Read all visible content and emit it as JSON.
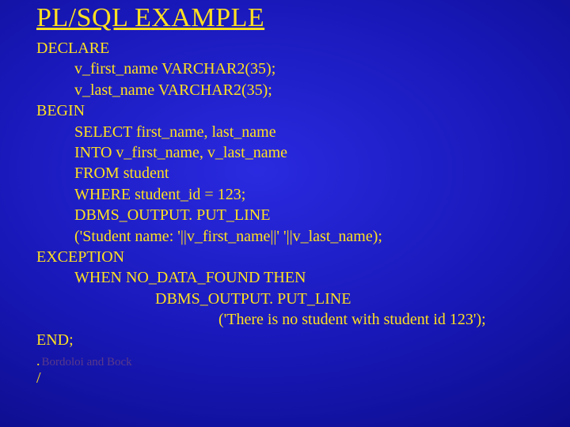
{
  "title": "PL/SQL EXAMPLE",
  "code": {
    "l0": "DECLARE",
    "l1": "v_first_name VARCHAR2(35);",
    "l2": "v_last_name VARCHAR2(35);",
    "l3": "BEGIN",
    "l4": "SELECT first_name, last_name",
    "l5": "INTO v_first_name, v_last_name",
    "l6": "FROM student",
    "l7": "WHERE student_id = 123;",
    "l8": "DBMS_OUTPUT. PUT_LINE",
    "l9": "('Student name: '||v_first_name||' '||v_last_name);",
    "l10": "EXCEPTION",
    "l11": "WHEN NO_DATA_FOUND THEN",
    "l12": "DBMS_OUTPUT. PUT_LINE",
    "l13": "('There is no student with student id 123');",
    "l14": "END;",
    "l15": ".",
    "l16": "/"
  },
  "footer": "Bordoloi and Bock"
}
